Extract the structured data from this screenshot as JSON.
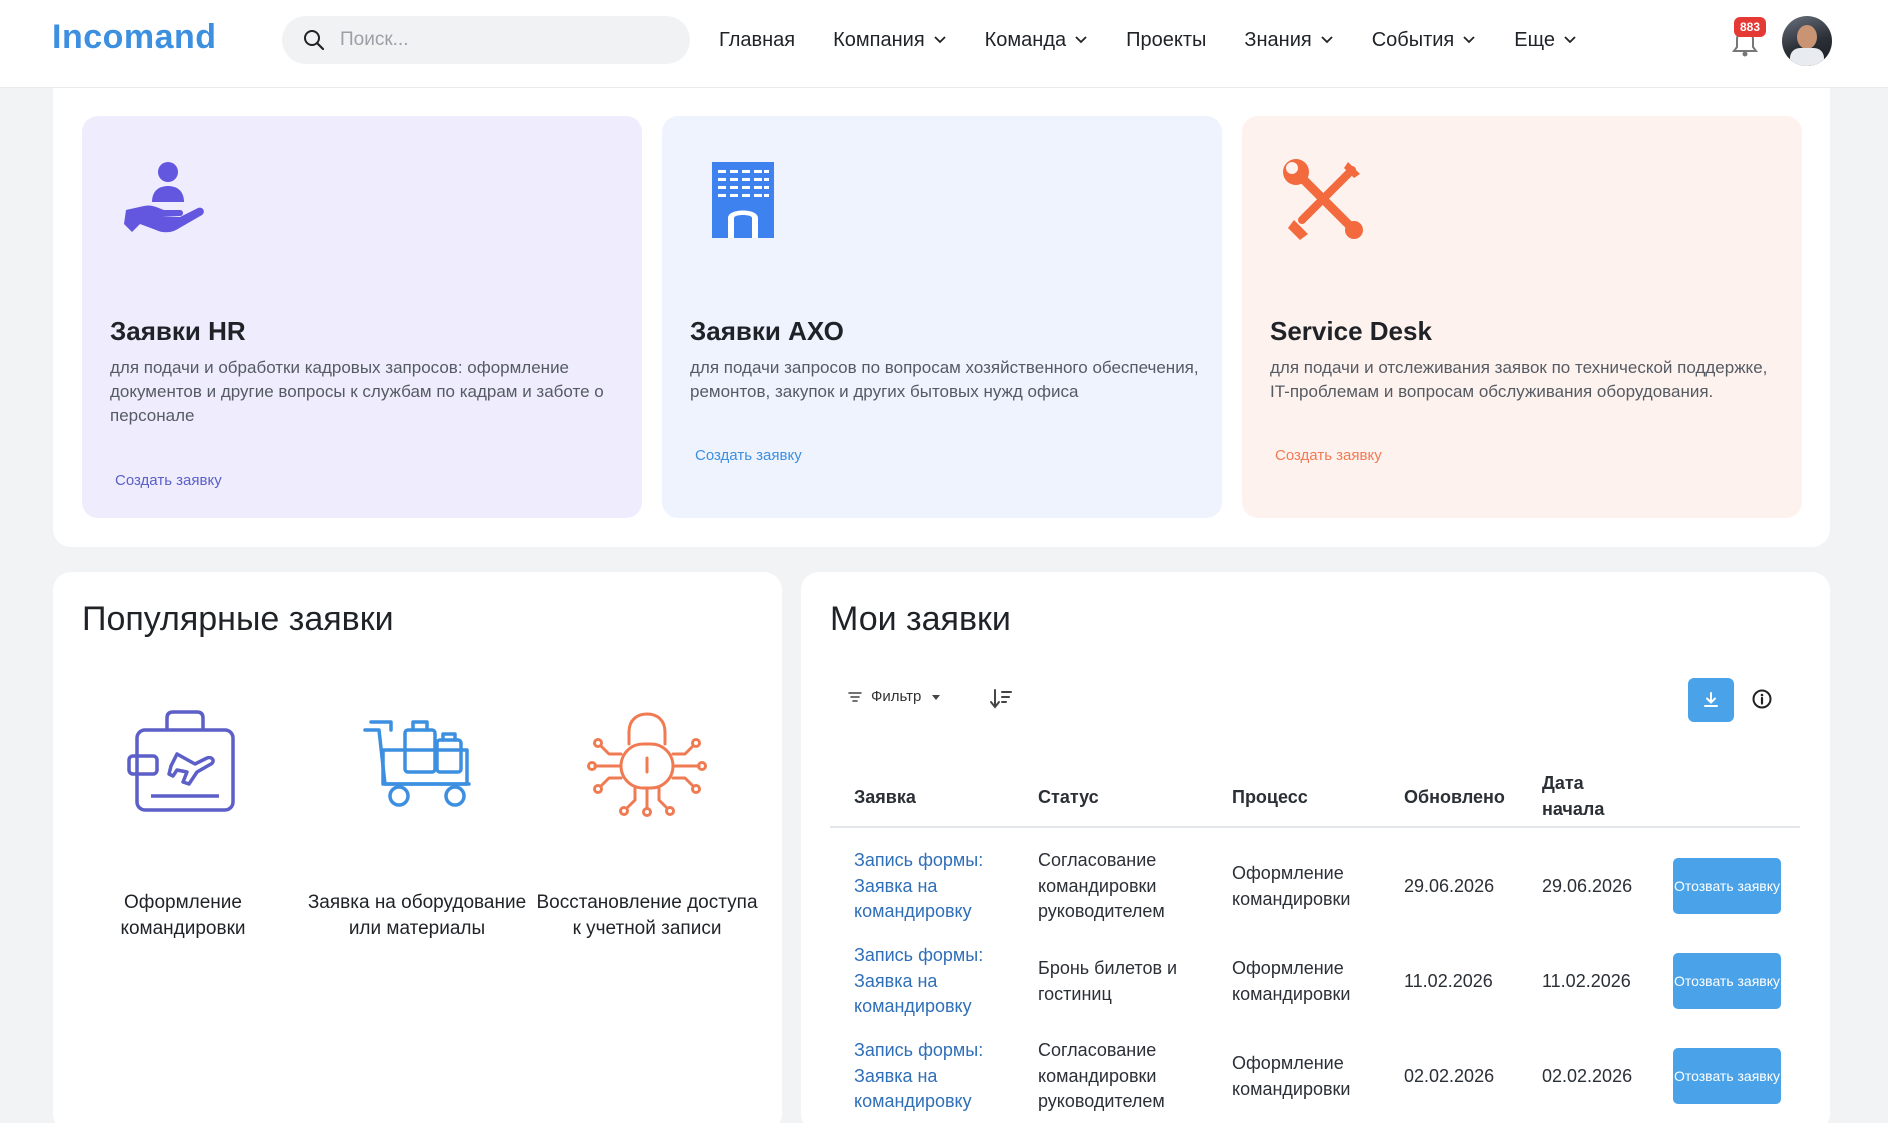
{
  "app": {
    "logo": "Incomand"
  },
  "search": {
    "placeholder": "Поиск..."
  },
  "nav": {
    "home": "Главная",
    "company": "Компания",
    "team": "Команда",
    "projects": "Проекты",
    "knowledge": "Знания",
    "events": "События",
    "more": "Еще"
  },
  "notifications": {
    "count": "883"
  },
  "cards": {
    "hr": {
      "title": "Заявки HR",
      "desc": "для подачи и обработки кадровых запросов: оформление документов  и другие вопросы к службам по кадрам и заботе о персонале",
      "link": "Создать заявку"
    },
    "axo": {
      "title": "Заявки АХО",
      "desc": "для подачи запросов по вопросам хозяйственного обеспечения, ремонтов, закупок и других бытовых нужд офиса",
      "link": "Создать заявку"
    },
    "sd": {
      "title": "Service Desk",
      "desc": "для подачи и отслеживания заявок по технической поддержке, IT-проблемам и вопросам обслуживания оборудования.",
      "link": "Создать заявку"
    }
  },
  "popular": {
    "title": "Популярные заявки",
    "items": [
      {
        "label": "Оформление командировки"
      },
      {
        "label": "Заявка на оборудование или материалы"
      },
      {
        "label": "Восстановление доступа к учетной записи"
      }
    ]
  },
  "my": {
    "title": "Мои заявки",
    "filter": "Фильтр",
    "columns": {
      "request": "Заявка",
      "status": "Статус",
      "process": "Процесс",
      "updated": "Обновлено",
      "start": "Дата начала"
    },
    "rows": [
      {
        "request": "Запись формы: Заявка на командировку",
        "status": "Согласование командировки руководителем",
        "process": "Оформление командировки",
        "updated": "29.06.2026",
        "start": "29.06.2026",
        "action": "Отозвать заявку"
      },
      {
        "request": "Запись формы: Заявка на командировку",
        "status": "Бронь билетов и гостиниц",
        "process": "Оформление командировки",
        "updated": "11.02.2026",
        "start": "11.02.2026",
        "action": "Отозвать заявку"
      },
      {
        "request": "Запись формы: Заявка на командировку",
        "status": "Согласование командировки руководителем",
        "process": "Оформление командировки",
        "updated": "02.02.2026",
        "start": "02.02.2026",
        "action": "Отозвать заявку"
      }
    ]
  },
  "colors": {
    "accent": "#4aa3e8",
    "hr": "#5b5fc7",
    "axo": "#3d8fe0",
    "sd": "#f07b52"
  }
}
